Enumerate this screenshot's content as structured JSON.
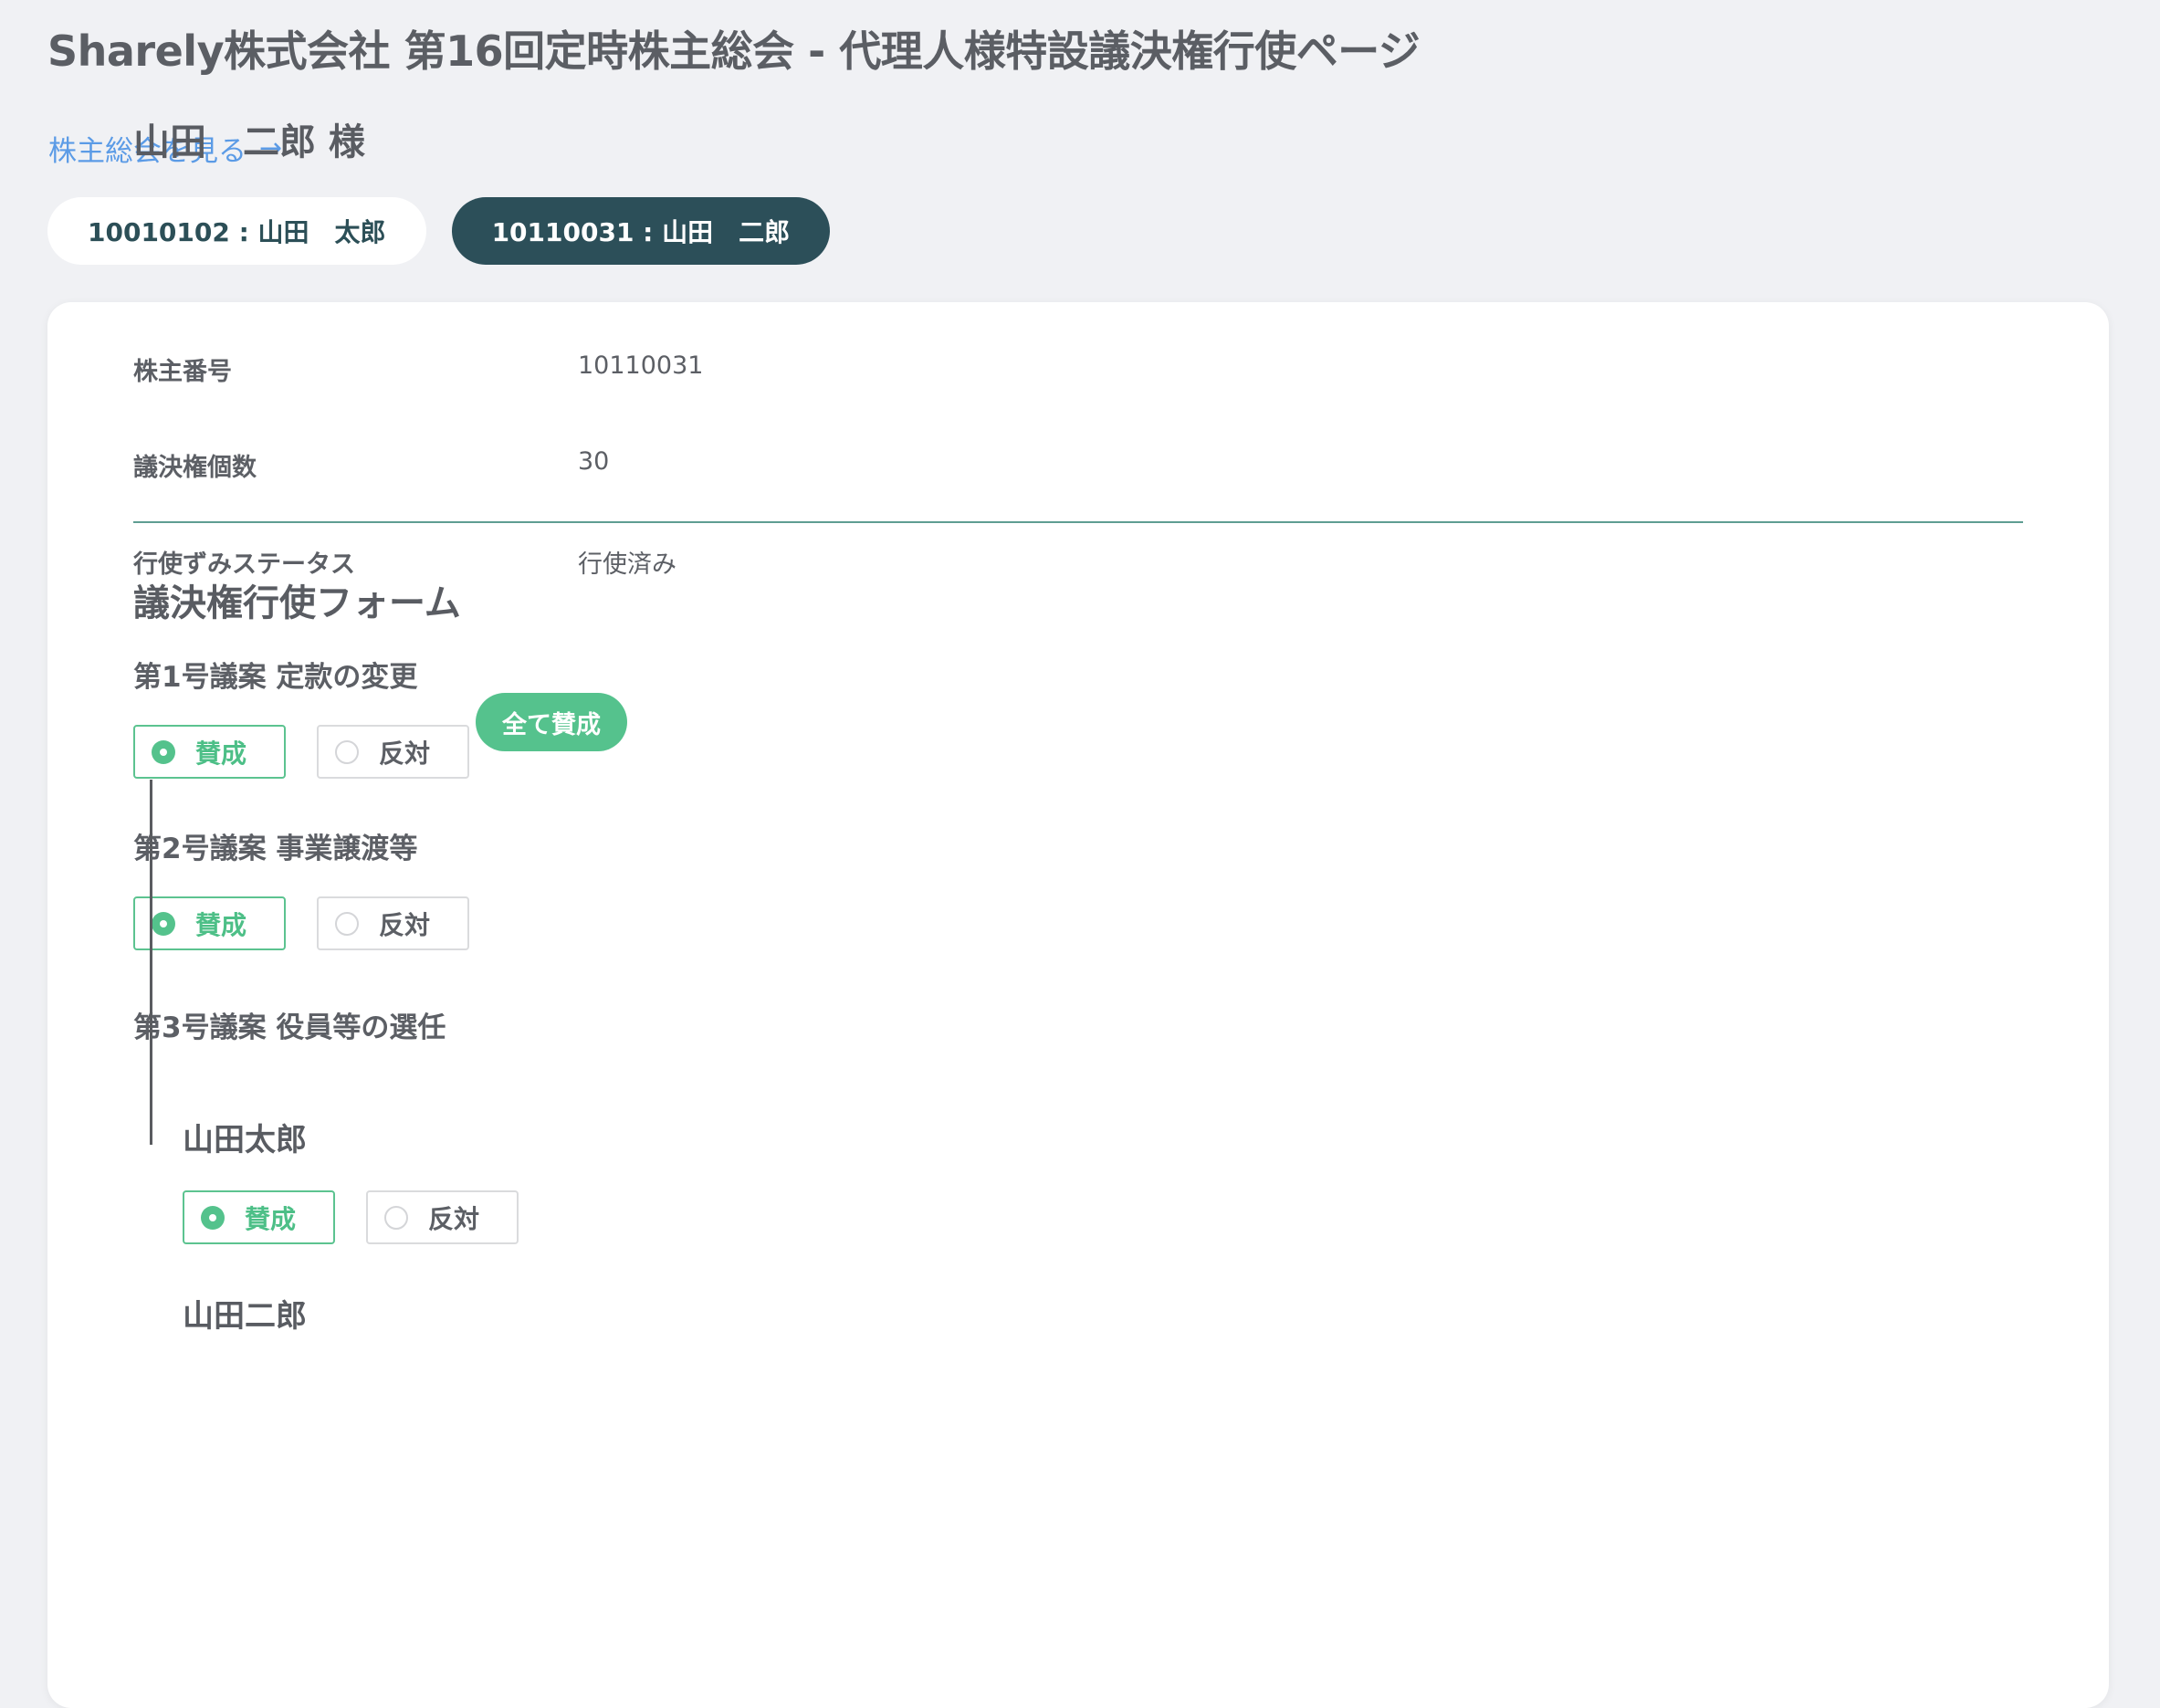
{
  "header": {
    "title": "Sharely株式会社 第16回定時株主総会 - 代理人様特設議決権行使ページ",
    "meeting_link": "株主総会を見る",
    "meeting_link_icon": "arrow-right-icon"
  },
  "holder_tabs": [
    {
      "label": "10010102 : 山田　太郎",
      "active": false
    },
    {
      "label": "10110031 : 山田　二郎",
      "active": true
    }
  ],
  "holder": {
    "name": "山田　二郎 様",
    "info": [
      {
        "label": "株主番号",
        "value": "10110031"
      },
      {
        "label": "議決権個数",
        "value": "30"
      },
      {
        "label": "行使ずみステータス",
        "value": "行使済み"
      }
    ]
  },
  "form": {
    "title": "議決権行使フォーム",
    "agree_label": "賛成",
    "disagree_label": "反対",
    "all_agree_label": "全て賛成",
    "proposals": [
      {
        "title": "第1号議案 定款の変更",
        "vote": "賛成"
      },
      {
        "title": "第2号議案 事業譲渡等",
        "vote": "賛成"
      },
      {
        "title": "第3号議案 役員等の選任",
        "candidates": [
          {
            "name": "山田太郎",
            "vote": "賛成"
          },
          {
            "name": "山田二郎"
          }
        ]
      }
    ]
  },
  "colors": {
    "background": "#f0f1f4",
    "accent_green": "#55c28d",
    "active_tab": "#2c4f59",
    "link": "#5b9be6",
    "divider": "#5e9d92"
  }
}
